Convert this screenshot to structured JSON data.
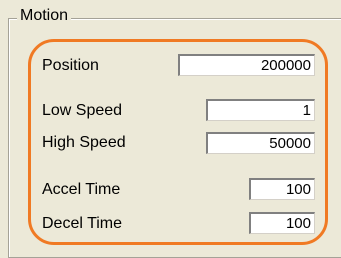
{
  "group": {
    "title": "Motion"
  },
  "fields": {
    "position": {
      "label": "Position",
      "value": "200000"
    },
    "low_speed": {
      "label": "Low Speed",
      "value": "1"
    },
    "high_speed": {
      "label": "High Speed",
      "value": "50000"
    },
    "accel_time": {
      "label": "Accel Time",
      "value": "100"
    },
    "decel_time": {
      "label": "Decel Time",
      "value": "100"
    }
  },
  "colors": {
    "panel_background": "#ece9d8",
    "highlight_outline": "#f07a24",
    "field_background": "#ffffff"
  }
}
